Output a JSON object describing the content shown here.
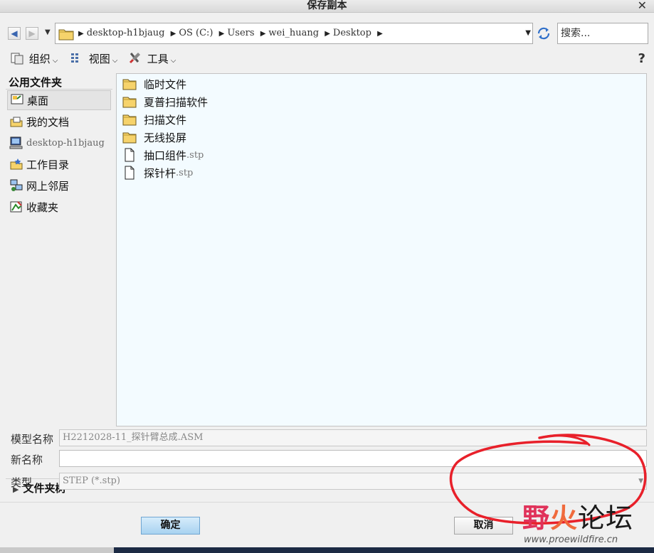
{
  "window": {
    "title": "保存副本",
    "close_glyph": "✕"
  },
  "nav": {
    "back_icon": "back-arrow-icon",
    "forward_icon": "forward-arrow-icon",
    "crumbs": [
      "desktop-h1bjaug",
      "OS (C:)",
      "Users",
      "wei_huang",
      "Desktop"
    ],
    "search_placeholder": "搜索..."
  },
  "toolbar": {
    "organize": "组织",
    "view": "视图",
    "tools": "工具"
  },
  "sidebar": {
    "header": "公用文件夹",
    "items": [
      {
        "label": "桌面",
        "icon": "desktop-icon"
      },
      {
        "label": "我的文档",
        "icon": "my-documents-icon"
      },
      {
        "label": "desktop-h1bjaug",
        "icon": "computer-icon"
      },
      {
        "label": "工作目录",
        "icon": "working-directory-icon"
      },
      {
        "label": "网上邻居",
        "icon": "network-icon"
      },
      {
        "label": "收藏夹",
        "icon": "favorites-icon"
      }
    ],
    "tree_toggle": "文件夹树"
  },
  "files": [
    {
      "name": "临时文件",
      "ext": "",
      "type": "folder"
    },
    {
      "name": "夏普扫描软件",
      "ext": "",
      "type": "folder"
    },
    {
      "name": "扫描文件",
      "ext": "",
      "type": "folder"
    },
    {
      "name": "无线投屏",
      "ext": "",
      "type": "folder"
    },
    {
      "name": "抽口组件",
      "ext": ".stp",
      "type": "file"
    },
    {
      "name": "探针杆",
      "ext": ".stp",
      "type": "file"
    }
  ],
  "form": {
    "model_label": "模型名称",
    "model_value": "H2212028-11_探针臂总成.ASM",
    "newname_label": "新名称",
    "newname_value": "",
    "type_label": "类型",
    "type_value": "STEP (*.stp)"
  },
  "buttons": {
    "ok": "确定",
    "cancel": "取消"
  },
  "watermark": {
    "a": "野",
    "b": "火",
    "c": "论坛",
    "url": "www.proewildfire.cn"
  },
  "colors": {
    "ok_button": "#a8d2f0",
    "file_list_bg": "#f3fbff",
    "annotation": "#e8202a"
  }
}
